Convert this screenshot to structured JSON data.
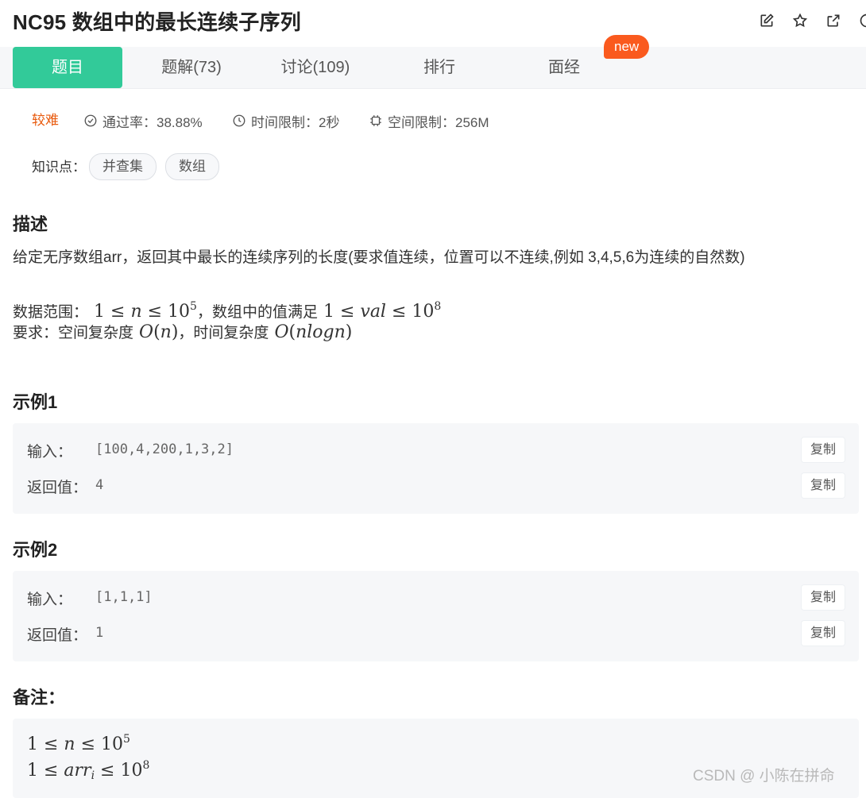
{
  "header": {
    "title": "NC95  数组中的最长连续子序列",
    "icons": [
      "edit-icon",
      "star-icon",
      "external-link-icon",
      "info-icon"
    ]
  },
  "tabs": [
    {
      "label": "题目",
      "active": true
    },
    {
      "label": "题解(73)",
      "active": false
    },
    {
      "label": "讨论(109)",
      "active": false
    },
    {
      "label": "排行",
      "active": false
    },
    {
      "label": "面经",
      "active": false
    }
  ],
  "new_badge": "new",
  "meta": {
    "difficulty": "较难",
    "pass_rate": "通过率：38.88%",
    "time_limit": "时间限制：2秒",
    "memory_limit": "空间限制：256M"
  },
  "knowledge": {
    "label": "知识点：",
    "tags": [
      "并查集",
      "数组"
    ]
  },
  "description": {
    "heading": "描述",
    "text": "给定无序数组arr，返回其中最长的连续序列的长度(要求值连续，位置可以不连续,例如 3,4,5,6为连续的自然数)",
    "range_prefix": "数据范围：",
    "range_mid": "，数组中的值满足",
    "req_prefix": "要求：空间复杂度",
    "req_mid": "，时间复杂度"
  },
  "examples": [
    {
      "heading": "示例1",
      "input_label": "输入：",
      "input": "[100,4,200,1,3,2]",
      "output_label": "返回值：",
      "output": "4",
      "copy_label": "复制"
    },
    {
      "heading": "示例2",
      "input_label": "输入：",
      "input": "[1,1,1]",
      "output_label": "返回值：",
      "output": "1",
      "copy_label": "复制"
    }
  ],
  "notes": {
    "heading": "备注："
  },
  "watermark": "CSDN @ 小陈在拼命",
  "colors": {
    "accent": "#32ca99",
    "difficulty": "#e8590c",
    "badge": "#fa5a1e"
  }
}
